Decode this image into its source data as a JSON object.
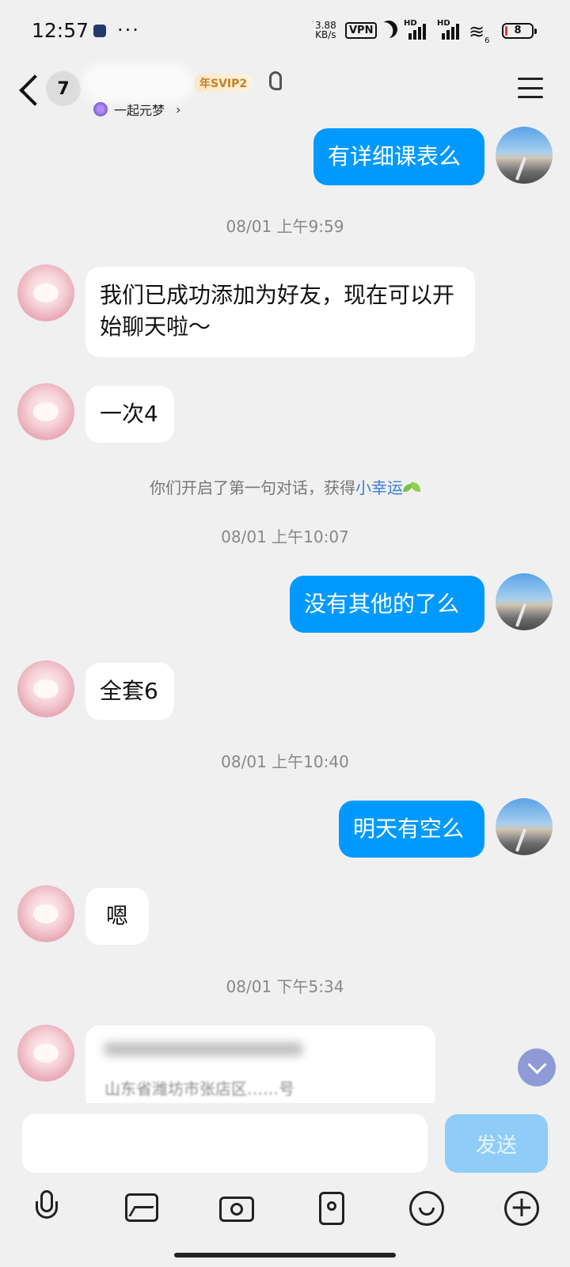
{
  "status_bar": {
    "time": "12:57",
    "dots": "···",
    "speed_value": "3.88",
    "speed_unit": "KB/s",
    "vpn": "VPN",
    "hd1": "HD",
    "hd2": "HD",
    "wifi_sub": "6",
    "battery": "8",
    "battery_level": 0.08,
    "battery_color": "#e53935"
  },
  "header": {
    "unread_count": "7",
    "vip_badge": "年SVIP2",
    "sub_status": "一起元梦",
    "sub_chevron": "›"
  },
  "messages": {
    "m1": "有详细课表么",
    "ts1": "08/01 上午9:59",
    "m2": "我们已成功添加为好友，现在可以开始聊天啦～",
    "m3": "一次4",
    "sys_prefix": "你们开启了第一句对话，获得",
    "sys_link": "小幸运",
    "ts2": "08/01 上午10:07",
    "m4": "没有其他的了么",
    "m5": "全套6",
    "ts3": "08/01 上午10:40",
    "m6": "明天有空么",
    "m7": "嗯",
    "ts4": "08/01 下午5:34",
    "card_line2": "山东省潍坊市张店区……号"
  },
  "input": {
    "placeholder": "",
    "send_label": "发送"
  },
  "colors": {
    "accent": "#0099ff",
    "send_disabled": "#8fcdf8",
    "background": "#f0f0f0"
  },
  "icons": [
    "back-icon",
    "menu-icon",
    "mic-icon",
    "image-icon",
    "camera-icon",
    "red-packet-icon",
    "emoji-icon",
    "plus-icon",
    "scroll-down-icon"
  ]
}
